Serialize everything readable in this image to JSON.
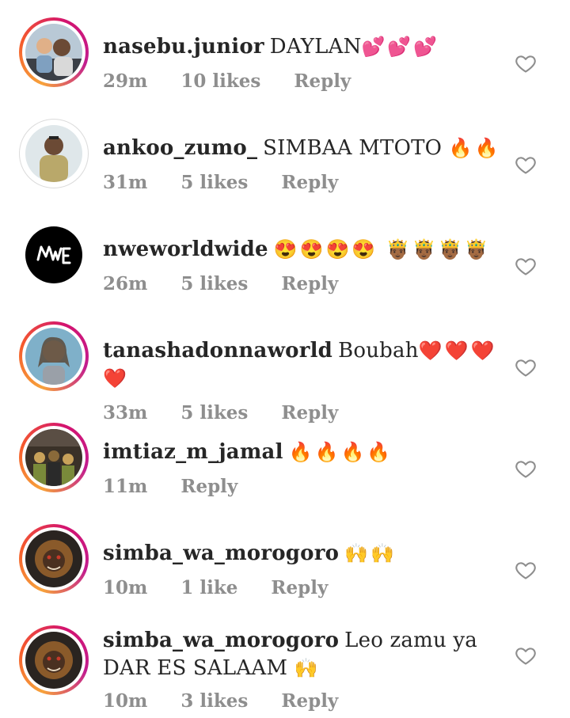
{
  "comments": [
    {
      "username": "nasebu.junior",
      "text": "DAYLAN",
      "emoji": "💕💕💕",
      "time": "29m",
      "likes": "10 likes",
      "reply": "Reply",
      "avatar_style": "story",
      "avatar_colors": [
        "#b9c9d6",
        "#e0b088",
        "#3b3f46"
      ]
    },
    {
      "username": "ankoo_zumo_",
      "text": "SIMBAA MTOTO",
      "emoji": "🔥🔥",
      "time": "31m",
      "likes": "5 likes",
      "reply": "Reply",
      "avatar_style": "plain",
      "avatar_colors": [
        "#dfe7ea",
        "#b9a86a",
        "#6b4a35"
      ]
    },
    {
      "username": "nweworldwide",
      "text": "",
      "emoji": "😍😍😍😍 🤴🏾🤴🏾🤴🏾🤴🏾",
      "time": "26m",
      "likes": "5 likes",
      "reply": "Reply",
      "avatar_style": "none",
      "avatar_colors": [
        "#000000",
        "#ffffff"
      ]
    },
    {
      "username": "tanashadonnaworld",
      "text": "Boubah",
      "emoji": "❤️❤️❤️❤️",
      "time": "33m",
      "likes": "5 likes",
      "reply": "Reply",
      "avatar_style": "story",
      "avatar_colors": [
        "#7fb0c9",
        "#d6b49a",
        "#5b4a3a"
      ]
    },
    {
      "username": "imtiaz_m_jamal",
      "text": "",
      "emoji": "🔥🔥🔥🔥",
      "time": "11m",
      "likes": "",
      "reply": "Reply",
      "avatar_style": "story",
      "avatar_colors": [
        "#3a3128",
        "#7a8a3a",
        "#c9a25a"
      ]
    },
    {
      "username": "simba_wa_morogoro",
      "text": "",
      "emoji": "🙌🙌",
      "time": "10m",
      "likes": "1 like",
      "reply": "Reply",
      "avatar_style": "story",
      "avatar_colors": [
        "#2a2420",
        "#8a5a2a",
        "#c73a2a"
      ]
    },
    {
      "username": "simba_wa_morogoro",
      "text": "Leo zamu ya DAR ES SALAAM",
      "emoji": "🙌",
      "time": "10m",
      "likes": "3 likes",
      "reply": "Reply",
      "avatar_style": "story",
      "avatar_colors": [
        "#2a2420",
        "#8a5a2a",
        "#c73a2a"
      ]
    }
  ]
}
